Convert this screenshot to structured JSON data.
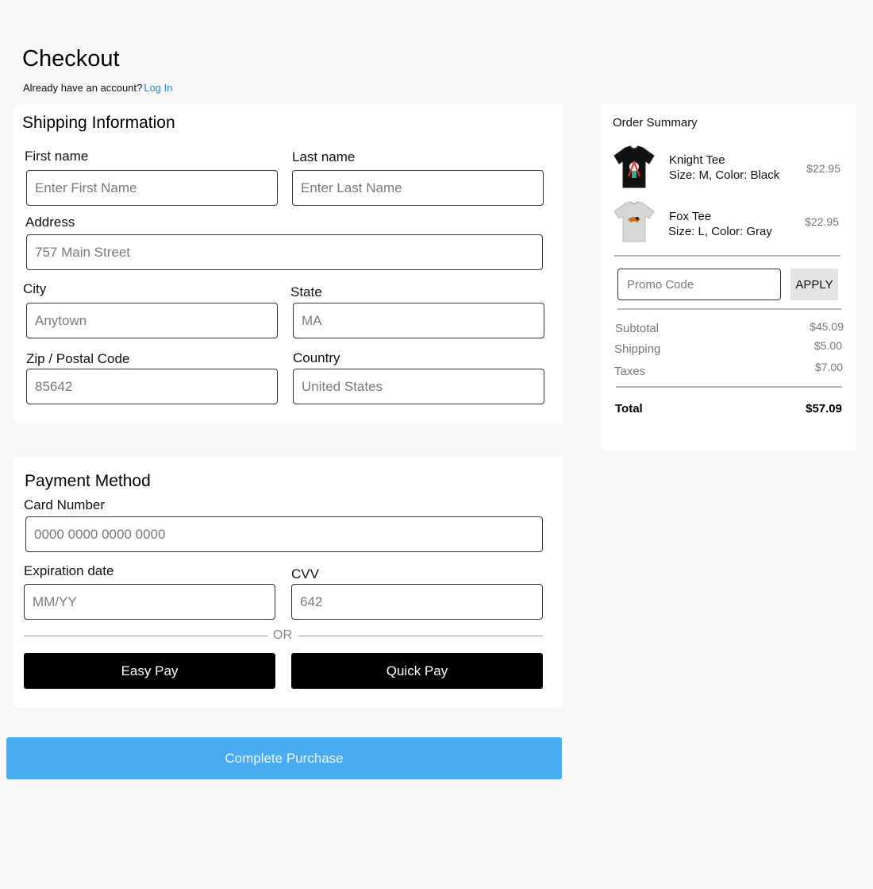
{
  "page": {
    "title": "Checkout",
    "account_prompt": "Already have an account?",
    "login_link": "Log In"
  },
  "shipping": {
    "title": "Shipping Information",
    "first_name_label": "First name",
    "first_name_placeholder": "Enter First Name",
    "last_name_label": "Last name",
    "last_name_placeholder": "Enter Last Name",
    "address_label": "Address",
    "address_placeholder": "757 Main Street",
    "city_label": "City",
    "city_placeholder": "Anytown",
    "state_label": "State",
    "state_placeholder": "MA",
    "zip_label": "Zip / Postal Code",
    "zip_placeholder": "85642",
    "country_label": "Country",
    "country_placeholder": "United States"
  },
  "payment": {
    "title": "Payment Method",
    "card_label": "Card Number",
    "card_placeholder": "0000 0000 0000 0000",
    "exp_label": "Expiration date",
    "exp_placeholder": "MM/YY",
    "cvv_label": "CVV",
    "cvv_placeholder": "642",
    "or_text": "OR",
    "easy_pay": "Easy Pay",
    "quick_pay": "Quick Pay"
  },
  "complete_button": "Complete Purchase",
  "summary": {
    "title": "Order Summary",
    "items": [
      {
        "name": "Knight Tee",
        "meta": "Size: M, Color: Black",
        "price": "$22.95",
        "icon": "black-tshirt-icon"
      },
      {
        "name": "Fox Tee",
        "meta": "Size: L, Color: Gray",
        "price": "$22.95",
        "icon": "gray-tshirt-icon"
      }
    ],
    "promo_placeholder": "Promo Code",
    "apply_label": "APPLY",
    "subtotal_label": "Subtotal",
    "subtotal_value": "$45.09",
    "shipping_label": "Shipping",
    "shipping_value": "$5.00",
    "taxes_label": "Taxes",
    "taxes_value": "$7.00",
    "total_label": "Total",
    "total_value": "$57.09"
  },
  "colors": {
    "background": "#f8f7fa",
    "link": "#2f86c9",
    "primary_button": "#4aacf0",
    "pay_button": "#000000"
  }
}
